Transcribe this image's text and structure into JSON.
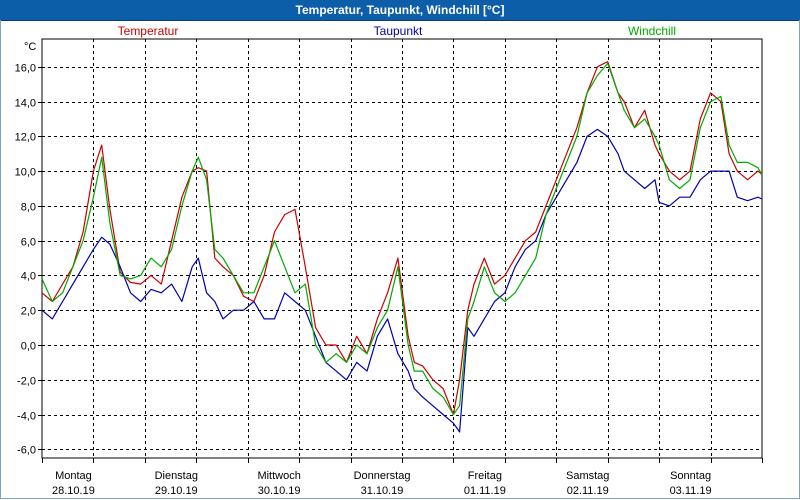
{
  "window": {
    "title": "Temperatur, Taupunkt, Windchill [°C]"
  },
  "chart_data": {
    "type": "line",
    "title": "Temperatur, Taupunkt, Windchill [°C]",
    "ylabel": "°C",
    "ylim": [
      -6.5,
      17.6
    ],
    "xlim": [
      0,
      7
    ],
    "grid": true,
    "legend_placement": "top",
    "yticks": [
      {
        "value": 16,
        "label": "16,0"
      },
      {
        "value": 14,
        "label": "14,0"
      },
      {
        "value": 12,
        "label": "12,0"
      },
      {
        "value": 10,
        "label": "10,0"
      },
      {
        "value": 8,
        "label": "8,0"
      },
      {
        "value": 6,
        "label": "6,0"
      },
      {
        "value": 4,
        "label": "4,0"
      },
      {
        "value": 2,
        "label": "2,0"
      },
      {
        "value": 0,
        "label": "0,0"
      },
      {
        "value": -2,
        "label": "-2,0"
      },
      {
        "value": -4,
        "label": "-4,0"
      },
      {
        "value": -6,
        "label": "-6,0"
      }
    ],
    "xticks": [
      {
        "x": 0,
        "day": "Montag",
        "date": "28.10.19"
      },
      {
        "x": 1,
        "day": "Dienstag",
        "date": "29.10.19"
      },
      {
        "x": 2,
        "day": "Mittwoch",
        "date": "30.10.19"
      },
      {
        "x": 3,
        "day": "Donnerstag",
        "date": "31.10.19"
      },
      {
        "x": 4,
        "day": "Freitag",
        "date": "01.11.19"
      },
      {
        "x": 5,
        "day": "Samstag",
        "date": "02.11.19"
      },
      {
        "x": 6,
        "day": "Sonntag",
        "date": "03.11.19"
      }
    ],
    "series": [
      {
        "name": "Temperatur",
        "color": "#cc0000",
        "x": [
          0.0,
          0.1,
          0.2,
          0.3,
          0.4,
          0.5,
          0.58,
          0.66,
          0.76,
          0.86,
          0.96,
          1.06,
          1.16,
          1.26,
          1.36,
          1.46,
          1.52,
          1.6,
          1.68,
          1.76,
          1.86,
          1.96,
          2.06,
          2.16,
          2.26,
          2.36,
          2.46,
          2.56,
          2.66,
          2.76,
          2.86,
          2.96,
          3.06,
          3.16,
          3.26,
          3.36,
          3.46,
          3.56,
          3.62,
          3.7,
          3.8,
          3.9,
          4.0,
          4.06,
          4.14,
          4.2,
          4.3,
          4.4,
          4.5,
          4.6,
          4.7,
          4.8,
          4.9,
          5.0,
          5.1,
          5.2,
          5.3,
          5.4,
          5.5,
          5.6,
          5.66,
          5.76,
          5.86,
          5.96,
          6.0,
          6.1,
          6.2,
          6.3,
          6.4,
          6.5,
          6.6,
          6.68,
          6.76,
          6.86,
          6.96,
          7.0
        ],
        "values": [
          3.0,
          2.5,
          3.5,
          4.5,
          6.5,
          10.0,
          11.5,
          7.8,
          4.2,
          3.6,
          3.5,
          4.0,
          3.5,
          6.0,
          8.5,
          10.0,
          10.2,
          10.0,
          5.0,
          4.5,
          4.0,
          2.8,
          2.5,
          4.0,
          6.5,
          7.5,
          7.8,
          4.5,
          1.0,
          0.0,
          0.0,
          -1.0,
          0.5,
          -0.5,
          1.5,
          3.0,
          5.0,
          0.5,
          -1.0,
          -1.2,
          -2.0,
          -2.5,
          -4.0,
          -2.0,
          2.0,
          3.5,
          5.0,
          3.5,
          4.0,
          5.0,
          6.0,
          6.5,
          8.0,
          9.5,
          11.0,
          12.5,
          14.5,
          16.0,
          16.3,
          14.5,
          14.0,
          12.5,
          13.5,
          11.5,
          11.0,
          10.0,
          9.5,
          10.0,
          13.0,
          14.5,
          14.0,
          11.0,
          10.0,
          9.5,
          10.0,
          9.8
        ]
      },
      {
        "name": "Taupunkt",
        "color": "#0000aa",
        "x": [
          0.0,
          0.1,
          0.2,
          0.3,
          0.4,
          0.5,
          0.58,
          0.66,
          0.76,
          0.86,
          0.96,
          1.06,
          1.16,
          1.26,
          1.36,
          1.46,
          1.52,
          1.6,
          1.68,
          1.76,
          1.86,
          1.96,
          2.06,
          2.16,
          2.26,
          2.36,
          2.46,
          2.56,
          2.66,
          2.76,
          2.86,
          2.96,
          3.06,
          3.16,
          3.26,
          3.36,
          3.46,
          3.56,
          3.62,
          3.7,
          3.8,
          3.9,
          4.0,
          4.06,
          4.14,
          4.2,
          4.3,
          4.4,
          4.5,
          4.6,
          4.7,
          4.8,
          4.9,
          5.0,
          5.1,
          5.2,
          5.3,
          5.4,
          5.5,
          5.6,
          5.66,
          5.76,
          5.86,
          5.96,
          6.0,
          6.1,
          6.2,
          6.3,
          6.4,
          6.5,
          6.6,
          6.68,
          6.76,
          6.86,
          6.96,
          7.0
        ],
        "values": [
          2.0,
          1.5,
          2.5,
          3.5,
          4.5,
          5.5,
          6.2,
          5.8,
          4.5,
          3.0,
          2.5,
          3.2,
          3.0,
          3.5,
          2.5,
          4.5,
          5.0,
          3.0,
          2.5,
          1.5,
          2.0,
          2.0,
          2.5,
          1.5,
          1.5,
          3.0,
          2.5,
          2.0,
          0.5,
          -1.0,
          -1.5,
          -2.0,
          -1.0,
          -1.5,
          0.5,
          1.5,
          -0.5,
          -1.5,
          -2.5,
          -3.0,
          -3.5,
          -4.0,
          -4.5,
          -5.0,
          1.0,
          0.5,
          1.5,
          2.5,
          3.0,
          4.5,
          5.5,
          6.0,
          7.5,
          8.5,
          9.5,
          10.5,
          12.0,
          12.4,
          12.0,
          11.0,
          10.0,
          9.5,
          9.0,
          9.5,
          8.2,
          8.0,
          8.5,
          8.5,
          9.5,
          10.0,
          10.0,
          10.0,
          8.5,
          8.3,
          8.5,
          8.4
        ]
      },
      {
        "name": "Windchill",
        "color": "#00aa00",
        "x": [
          0.0,
          0.1,
          0.2,
          0.3,
          0.4,
          0.5,
          0.58,
          0.66,
          0.76,
          0.86,
          0.96,
          1.06,
          1.16,
          1.26,
          1.36,
          1.46,
          1.52,
          1.6,
          1.68,
          1.76,
          1.86,
          1.96,
          2.06,
          2.16,
          2.26,
          2.36,
          2.46,
          2.56,
          2.66,
          2.76,
          2.86,
          2.96,
          3.06,
          3.16,
          3.26,
          3.36,
          3.46,
          3.56,
          3.62,
          3.7,
          3.8,
          3.9,
          4.0,
          4.06,
          4.14,
          4.2,
          4.3,
          4.4,
          4.5,
          4.6,
          4.7,
          4.8,
          4.9,
          5.0,
          5.1,
          5.2,
          5.3,
          5.4,
          5.5,
          5.6,
          5.66,
          5.76,
          5.86,
          5.96,
          6.0,
          6.1,
          6.2,
          6.3,
          6.4,
          6.5,
          6.6,
          6.68,
          6.76,
          6.86,
          6.96,
          7.0
        ],
        "values": [
          3.8,
          2.5,
          3.0,
          4.5,
          6.0,
          8.5,
          10.8,
          7.0,
          4.0,
          3.8,
          4.0,
          5.0,
          4.5,
          5.5,
          8.0,
          10.0,
          10.8,
          9.5,
          5.5,
          5.0,
          4.0,
          3.0,
          3.0,
          4.5,
          6.0,
          4.5,
          3.0,
          3.5,
          0.0,
          -1.0,
          -0.5,
          -1.0,
          0.0,
          -0.5,
          1.0,
          2.0,
          4.5,
          0.0,
          -1.5,
          -1.5,
          -2.5,
          -3.0,
          -4.0,
          -3.5,
          1.5,
          2.5,
          4.5,
          3.0,
          2.5,
          3.0,
          4.0,
          5.0,
          7.5,
          9.0,
          10.5,
          12.0,
          14.5,
          15.5,
          16.2,
          14.5,
          13.5,
          12.5,
          13.0,
          12.0,
          11.5,
          9.5,
          9.0,
          9.5,
          12.5,
          14.0,
          14.3,
          11.5,
          10.5,
          10.5,
          10.2,
          9.8
        ]
      }
    ]
  }
}
